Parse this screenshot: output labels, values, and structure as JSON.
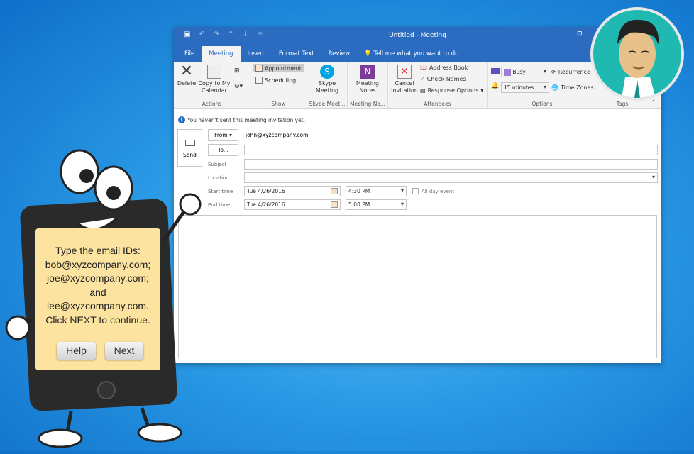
{
  "window": {
    "title": "Untitled - Meeting"
  },
  "tabs": [
    "File",
    "Meeting",
    "Insert",
    "Format Text",
    "Review",
    "Tell me what you want to do"
  ],
  "ribbon": {
    "actions": {
      "delete": "Delete",
      "copy": "Copy to My Calendar",
      "label": "Actions"
    },
    "show": {
      "appointment": "Appointment",
      "scheduling": "Scheduling",
      "label": "Show"
    },
    "skype": {
      "button": "Skype Meeting",
      "label": "Skype Meet..."
    },
    "notes": {
      "button": "Meeting Notes",
      "label": "Meeting No..."
    },
    "attendees": {
      "cancel": "Cancel Invitation",
      "address_book": "Address Book",
      "check_names": "Check Names",
      "response": "Response Options",
      "label": "Attendees"
    },
    "options": {
      "show_as": "Busy",
      "reminder": "15 minutes",
      "recurrence": "Recurrence",
      "time_zones": "Time Zones",
      "label": "Options"
    },
    "tags": {
      "label": "Tags"
    }
  },
  "info": "You haven't sent this meeting invitation yet.",
  "form": {
    "send": "Send",
    "from_btn": "From",
    "from_value": "john@xyzcompany.com",
    "to_btn": "To...",
    "to_value": "",
    "subject_label": "Subject",
    "subject_value": "",
    "location_label": "Location",
    "location_value": "",
    "start_label": "Start time",
    "start_date": "Tue 4/26/2016",
    "start_time": "4:30 PM",
    "all_day": "All day event",
    "end_label": "End time",
    "end_date": "Tue 4/26/2016",
    "end_time": "5:00 PM"
  },
  "mascot": {
    "lines": [
      "Type the email IDs:",
      "bob@xyzcompany.com;",
      "joe@xyzcompany.com;",
      "and",
      "lee@xyzcompany.com.",
      "Click NEXT to continue."
    ],
    "help": "Help",
    "next": "Next"
  },
  "colors": {
    "title_bar": "#2b6cc0",
    "card": "#fde3a0",
    "avatar_bg": "#1fb9b1"
  }
}
